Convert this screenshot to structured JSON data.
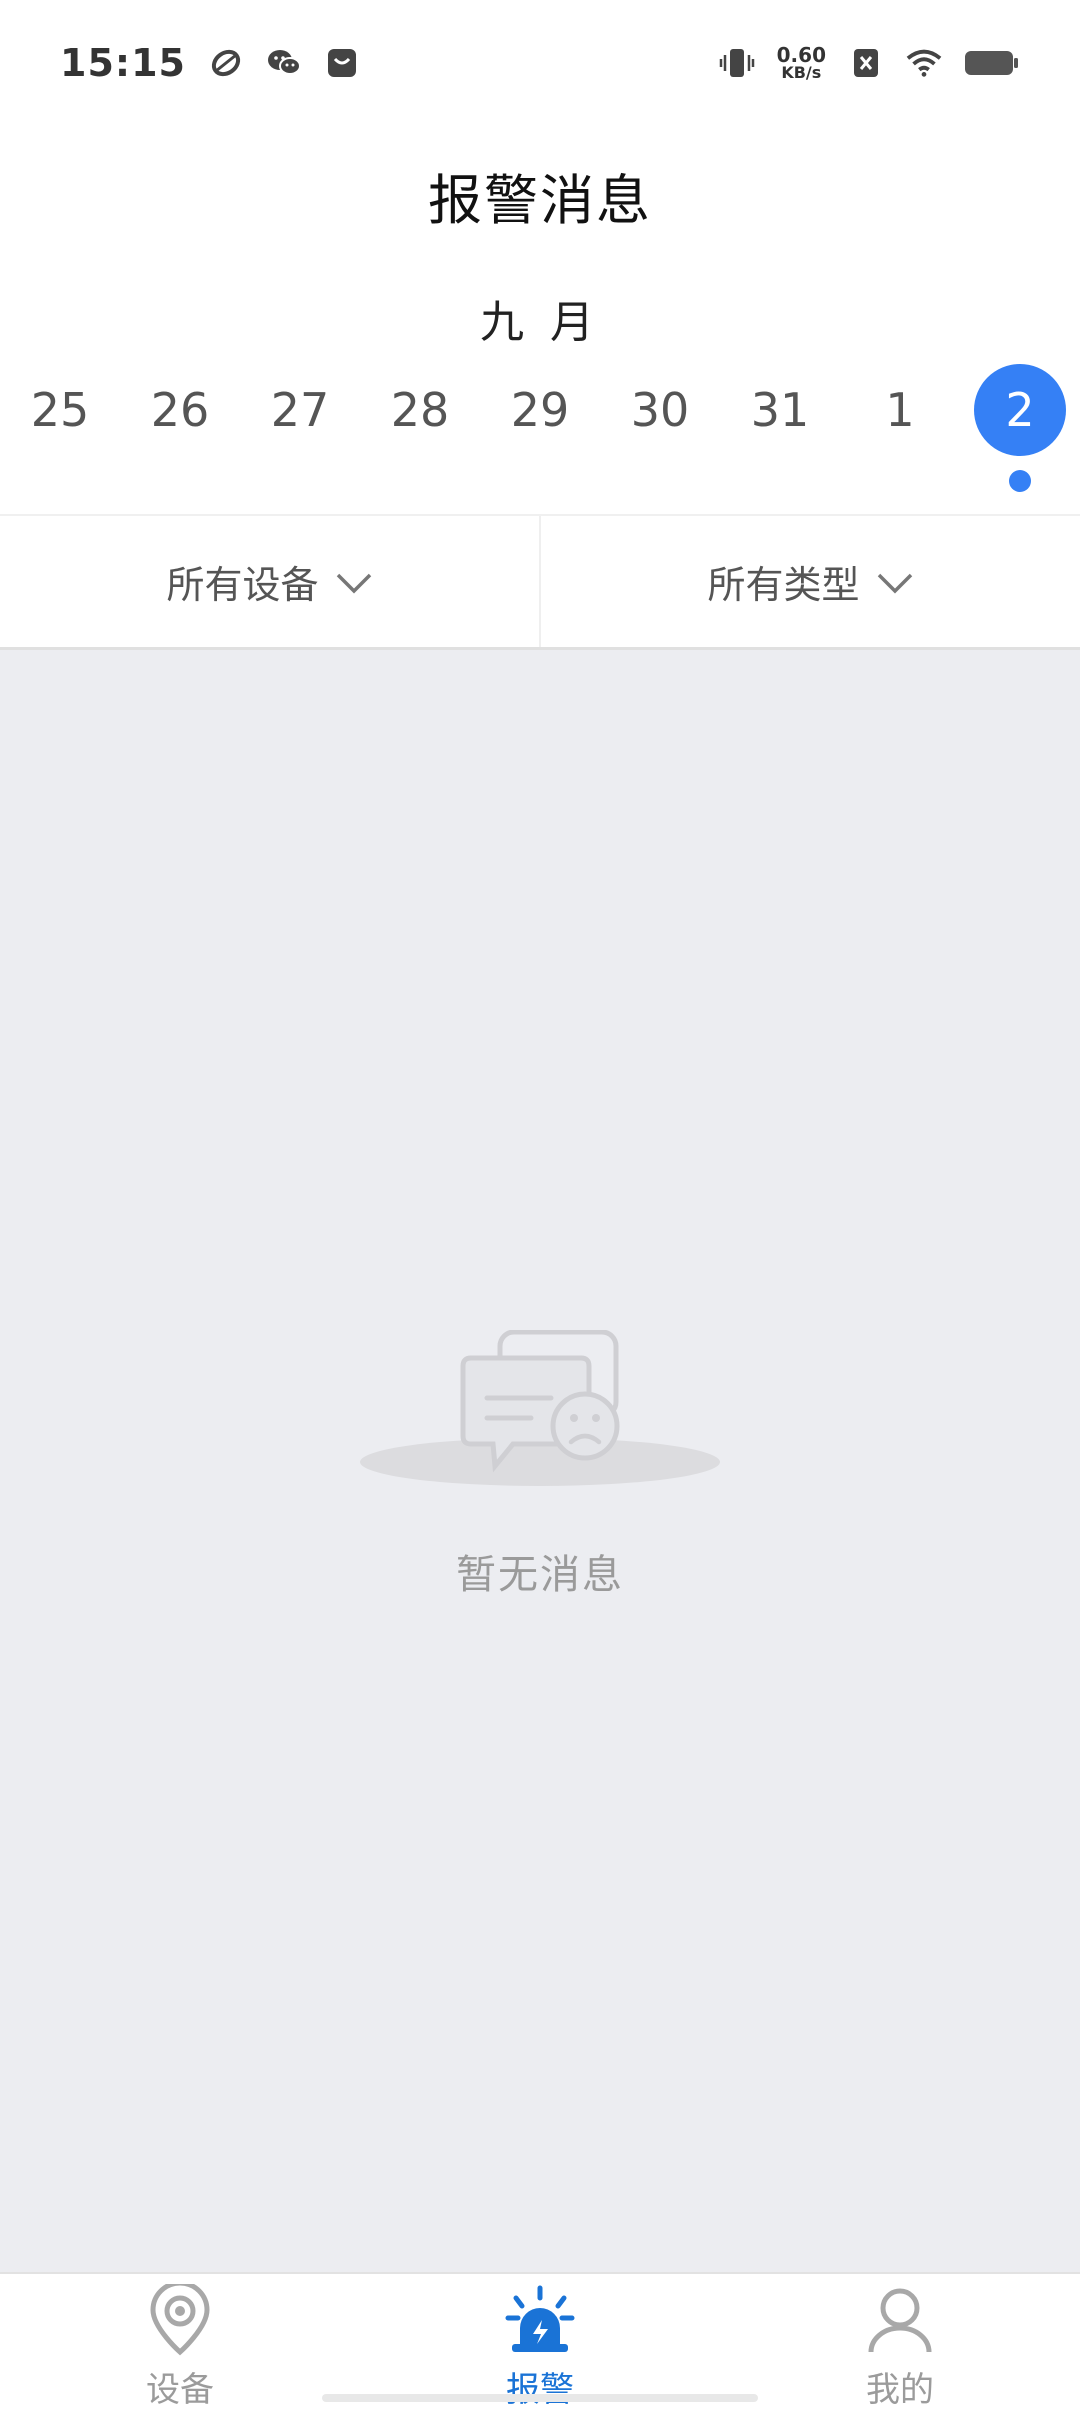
{
  "status_bar": {
    "time": "15:15",
    "net_speed_value": "0.60",
    "net_speed_unit": "KB/s",
    "icons": [
      "swirl-app-icon",
      "wechat-icon",
      "mail-notification-icon",
      "vibrate-icon",
      "sim-off-icon",
      "wifi-icon",
      "battery-icon"
    ]
  },
  "header": {
    "title": "报警消息"
  },
  "calendar": {
    "month": "九 月",
    "dates": [
      "25",
      "26",
      "27",
      "28",
      "29",
      "30",
      "31",
      "1",
      "2"
    ],
    "selected_index": 8,
    "accent_color": "#3580f5"
  },
  "filters": {
    "device": "所有设备",
    "type": "所有类型"
  },
  "empty_state": {
    "message": "暂无消息"
  },
  "tabbar": {
    "items": [
      {
        "label": "设备",
        "icon": "location-pin-icon",
        "active": false
      },
      {
        "label": "报警",
        "icon": "alarm-siren-icon",
        "active": true
      },
      {
        "label": "我的",
        "icon": "person-icon",
        "active": false
      }
    ],
    "active_color": "#1a73d6",
    "inactive_color": "#9b9b9b"
  }
}
